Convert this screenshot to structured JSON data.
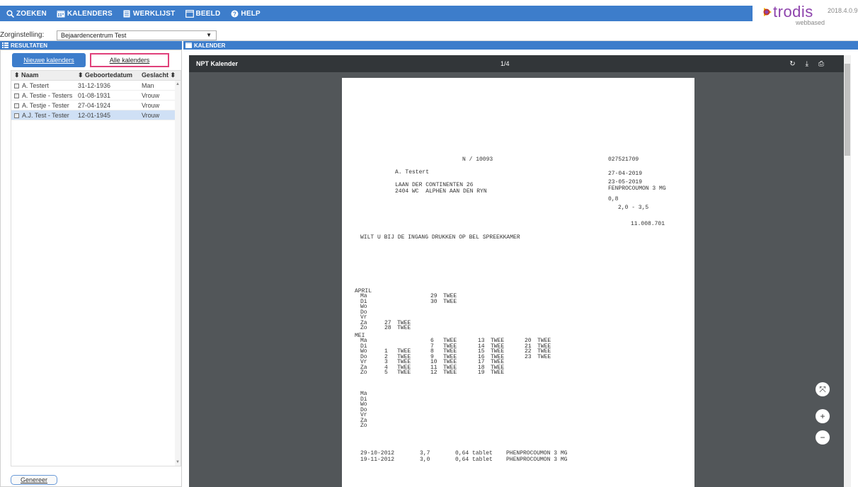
{
  "menu": [
    {
      "label": "ZOEKEN",
      "icon": "search-icon"
    },
    {
      "label": "KALENDERS",
      "icon": "calendar-icon"
    },
    {
      "label": "WERKLIJST",
      "icon": "list-icon"
    },
    {
      "label": "BEELD",
      "icon": "window-icon"
    },
    {
      "label": "HELP",
      "icon": "help-icon"
    }
  ],
  "brand": {
    "name": "trodis",
    "sub": "webbased",
    "version": "2018.4.0.9"
  },
  "zorg": {
    "label": "Zorginstelling:",
    "value": "Bejaardencentrum Test"
  },
  "left_panel": {
    "title": "RESULTATEN",
    "tab_new": "Nieuwe kalenders",
    "tab_all": "Alle kalenders",
    "columns": [
      "Naam",
      "Geboortedatum",
      "Geslacht"
    ],
    "rows": [
      [
        "A. Testert",
        "31-12-1936",
        "Man"
      ],
      [
        "A. Testie - Testers",
        "01-08-1931",
        "Vrouw"
      ],
      [
        "A. Testje - Tester",
        "27-04-1924",
        "Vrouw"
      ],
      [
        "A.J. Test - Tester",
        "12-01-1945",
        "Vrouw"
      ]
    ],
    "generate_label": "Genereer"
  },
  "right_panel": {
    "title": "KALENDER"
  },
  "viewer": {
    "title": "NPT Kalender",
    "page": "1/4"
  },
  "document": {
    "code": "N / 10093",
    "name": "A. Testert",
    "address1": "LAAN DER CONTINENTEN 26",
    "address2": "2404 WC  ALPHEN AAN DEN RYN",
    "id_no": "027521709",
    "date_from": "27-04-2019",
    "date_to": "23-05-2019",
    "medication": "FENPROCOUMON 3 MG",
    "dose": "0,8",
    "range": "2,0 - 3,5",
    "ref": "11.008.701",
    "notice": "WILT U BIJ DE INGANG DRUKKEN OP BEL SPREEKKAMER",
    "april_label": "APRIL",
    "mei_label": "MEI",
    "days": [
      "Ma",
      "Di",
      "Wo",
      "Do",
      "Vr",
      "Za",
      "Zo"
    ],
    "april_col1": [
      "",
      "",
      "",
      "",
      "",
      "27",
      "28"
    ],
    "april_col2": [
      "29",
      "30",
      "",
      "",
      "",
      "",
      ""
    ],
    "mei_col1": [
      "",
      "",
      "1",
      "2",
      "3",
      "4",
      "5"
    ],
    "mei_col2": [
      "6",
      "7",
      "8",
      "9",
      "10",
      "11",
      "12"
    ],
    "mei_col3": [
      "13",
      "14",
      "15",
      "16",
      "17",
      "18",
      "19"
    ],
    "mei_col4": [
      "20",
      "21",
      "22",
      "23",
      "",
      "",
      ""
    ],
    "twee": "TWEE",
    "history": [
      [
        "29-10-2012",
        "3,7",
        "0,64 tablet",
        "PHENPROCOUMON 3 MG"
      ],
      [
        "19-11-2012",
        "3,0",
        "0,64 tablet",
        "PHENPROCOUMON 3 MG"
      ]
    ]
  }
}
